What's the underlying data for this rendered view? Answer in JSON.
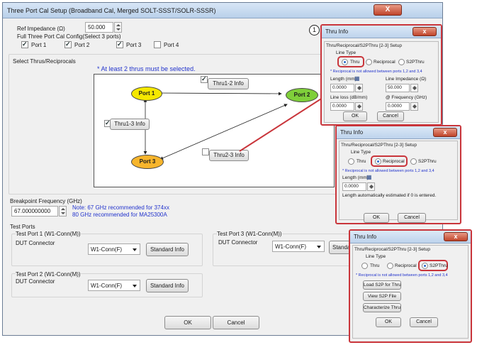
{
  "main": {
    "title": "Three Port Cal Setup (Broadband Cal, Merged SOLT-SSST/SOLR-SSSR)",
    "close_glyph": "X",
    "ref_impedance_label": "Ref Impedance (Ω)",
    "ref_impedance_value": "50.000",
    "config_group_label": "Full Three Port Cal Config(Select 3 ports)",
    "ports": [
      {
        "label": "Port 1",
        "checked": true
      },
      {
        "label": "Port 2",
        "checked": true
      },
      {
        "label": "Port 3",
        "checked": true
      },
      {
        "label": "Port 4",
        "checked": false
      }
    ],
    "thrus_group_label": "Select Thrus/Reciprocals",
    "thrus_note": "* At least 2 thrus must be selected.",
    "diagram": {
      "port1": "Port 1",
      "port2": "Port 2",
      "port3": "Port 3",
      "thru12": "Thru1-2 Info",
      "thru13": "Thru1-3 Info",
      "thru23": "Thru2-3 Info"
    },
    "breakpoint_label": "Breakpoint Frequency (GHz)",
    "breakpoint_value": "67.000000000",
    "breakpoint_note_line1": "Note: 67 GHz recommended for 374xx",
    "breakpoint_note_line2": "80 GHz recommended for MA25300A",
    "test_ports_label": "Test Ports",
    "tp1_label": "Test Port 1 (W1-Conn(M))",
    "tp2_label": "Test Port 2 (W1-Conn(M))",
    "tp3_label": "Test Port 3 (W1-Conn(M))",
    "dut_connector_label": "DUT Connector",
    "connector_value": "W1-Conn(F)",
    "standard_info": "Standard Info",
    "standard_info_cut": "Standa",
    "ok": "OK",
    "cancel": "Cancel"
  },
  "callout_number": "1",
  "popup1": {
    "title": "Thru Info",
    "setup_label": "Thru/Reciprocal/S2PThru [2-3] Setup",
    "line_type_label": "Line Type",
    "opt_thru": "Thru",
    "opt_reciprocal": "Reciprocal",
    "opt_s2pthru": "S2PThru",
    "selected": "Thru",
    "note": "* Reciprocal is not allowed between ports 1,2 and 3,4",
    "length_label": "Length (mm)",
    "length_value": "0.0000",
    "line_impedance_label": "Line Impedance (Ω)",
    "line_impedance_value": "50.000",
    "line_loss_label": "Line loss (dB/mm)",
    "line_loss_value": "0.0000",
    "at_freq_label": "@ Frequency (GHz)",
    "at_freq_value": "0.0000",
    "ok": "OK",
    "cancel": "Cancel"
  },
  "popup2": {
    "title": "Thru Info",
    "setup_label": "Thru/Reciprocal/S2PThru [2-3] Setup",
    "line_type_label": "Line Type",
    "opt_thru": "Thru",
    "opt_reciprocal": "Reciprocal",
    "opt_s2pthru": "S2PThru",
    "selected": "Reciprocal",
    "note": "* Reciprocal is not allowed between ports 1,2 and 3,4",
    "length_label": "Length (mm)",
    "length_value": "0.0000",
    "auto_note": "Length automatically estimated if 0 is entered.",
    "ok": "OK",
    "cancel": "Cancel"
  },
  "popup3": {
    "title": "Thru Info",
    "setup_label": "Thru/Reciprocal/S2PThru [2-3] Setup",
    "line_type_label": "Line Type",
    "opt_thru": "Thru",
    "opt_reciprocal": "Reciprocal",
    "opt_s2pthru": "S2PThru",
    "selected": "S2PThru",
    "note": "* Reciprocal is not allowed between ports 1,2 and 3,4",
    "load_s2p": "Load S2P for Thru",
    "view_s2p": "View S2P File",
    "characterize": "Characterize Thru",
    "ok": "OK",
    "cancel": "Cancel"
  },
  "colors": {
    "port_oval": "#f5e800",
    "port2_oval": "#7fcf3a",
    "port3_oval": "#f7b52c",
    "highlight": "#c9353b",
    "note_blue": "#2233cc"
  }
}
